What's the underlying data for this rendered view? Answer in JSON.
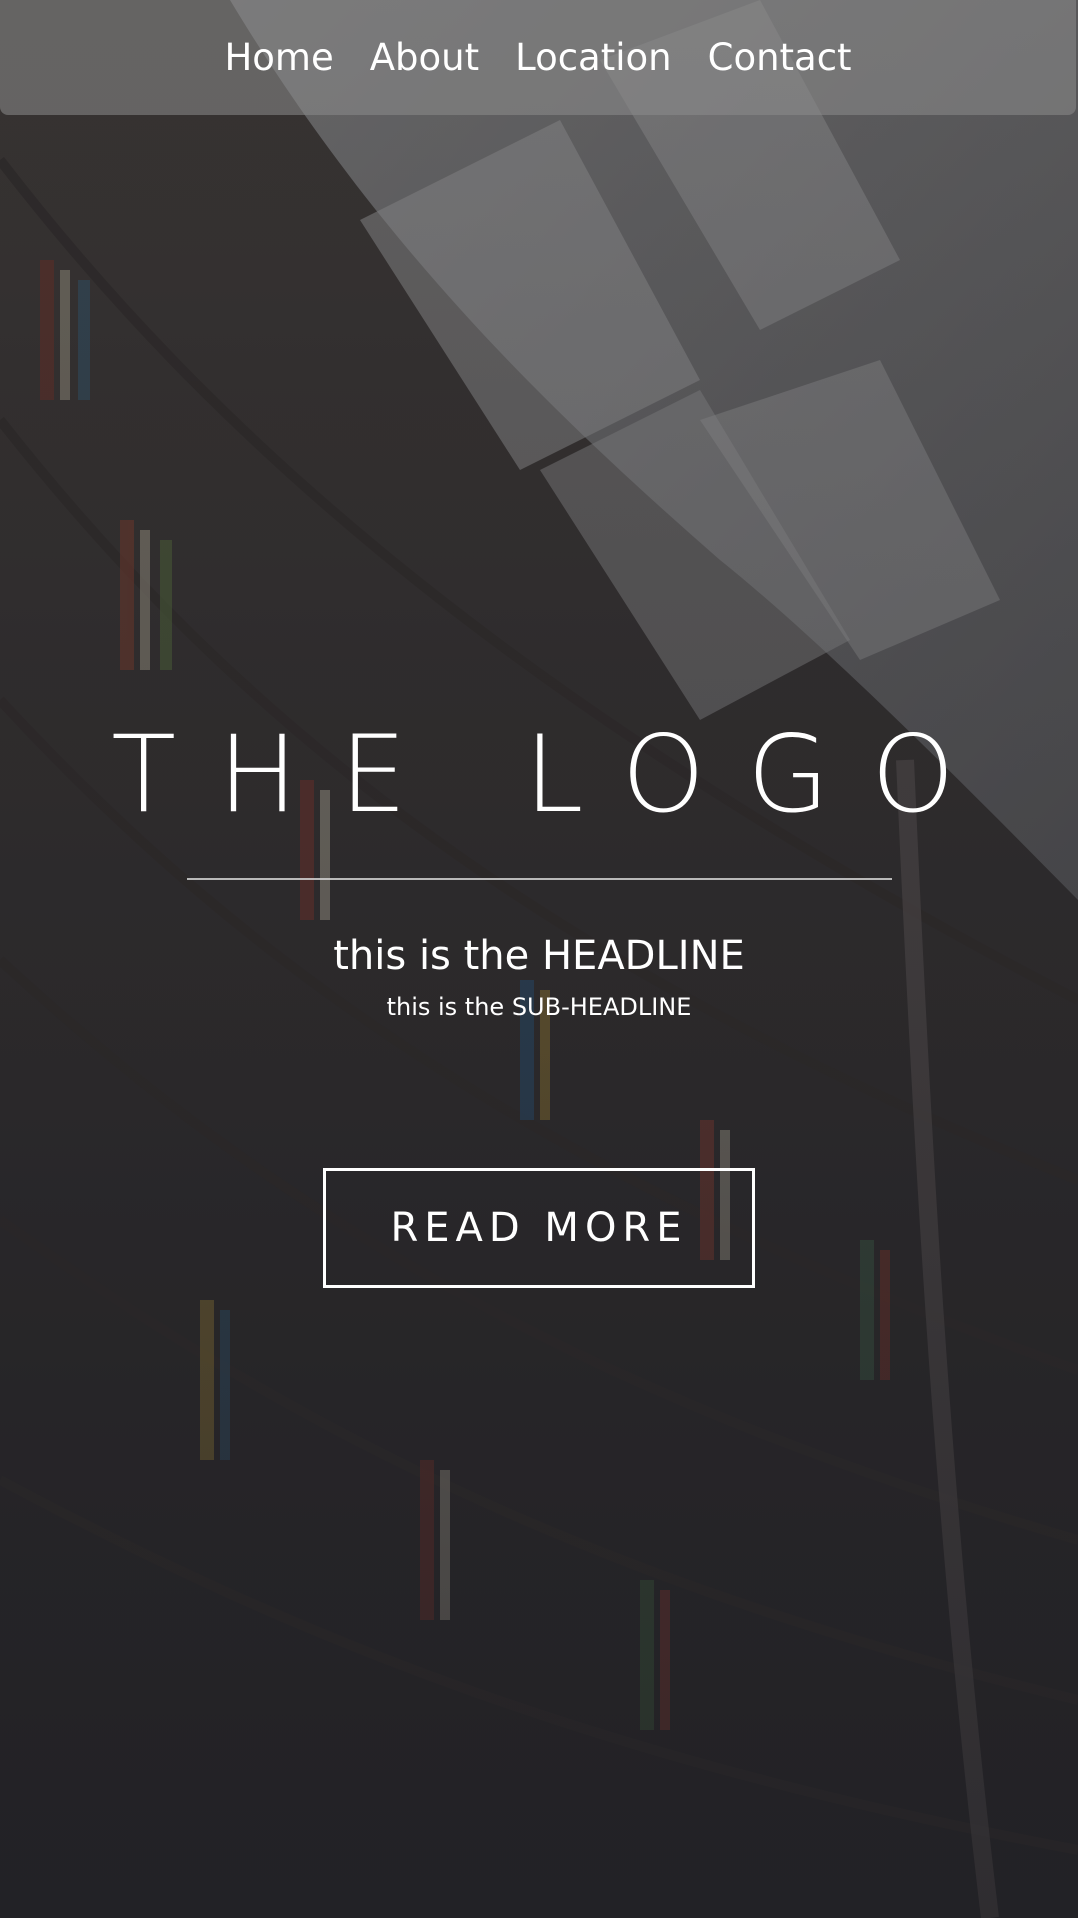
{
  "nav": {
    "items": [
      {
        "label": "Home"
      },
      {
        "label": "About"
      },
      {
        "label": "Location"
      },
      {
        "label": "Contact"
      }
    ]
  },
  "hero": {
    "logo": "THE LOGO",
    "headline": "this is the HEADLINE",
    "subheadline": "this is the SUB-HEADLINE",
    "cta_label": "READ MORE"
  },
  "colors": {
    "text": "#ffffff",
    "nav_bg": "#8c8c8c",
    "page_bg": "#34343a"
  }
}
